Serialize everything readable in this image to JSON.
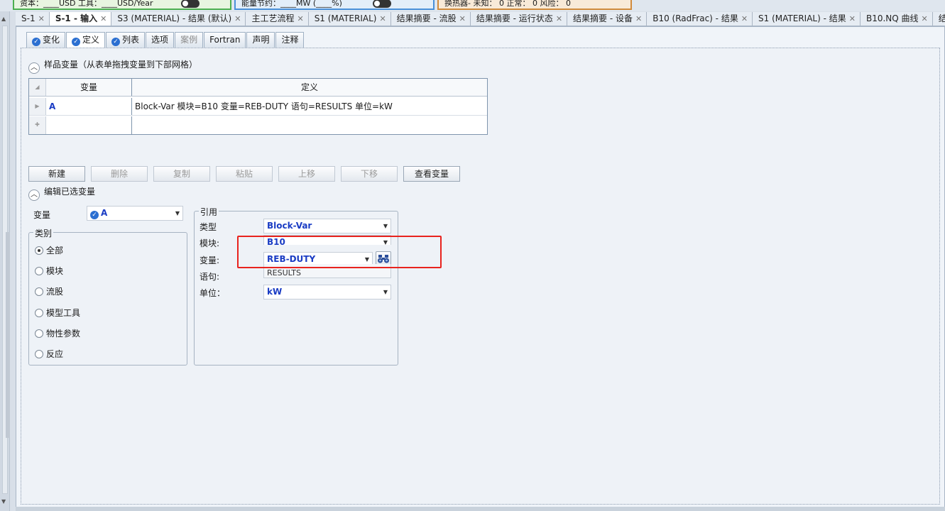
{
  "topstrip": {
    "cost": "资本：____USD  工具：____USD/Year",
    "energy": "能量节约：____MW    (____%)",
    "hx": "换热器-  未知：  0   正常：  0   风险：  0"
  },
  "doc_tabs": [
    {
      "label": "S-1",
      "active": false
    },
    {
      "label": "S-1 - 输入",
      "active": true
    },
    {
      "label": "S3 (MATERIAL) - 结果 (默认)",
      "active": false
    },
    {
      "label": "主工艺流程",
      "active": false
    },
    {
      "label": "S1 (MATERIAL)",
      "active": false
    },
    {
      "label": "结果摘要 - 流股",
      "active": false
    },
    {
      "label": "结果摘要 - 运行状态",
      "active": false
    },
    {
      "label": "结果摘要 - 设备",
      "active": false
    },
    {
      "label": "B10 (RadFrac) - 结果",
      "active": false
    },
    {
      "label": "S1 (MATERIAL) - 结果",
      "active": false
    },
    {
      "label": "B10.NQ 曲线",
      "active": false
    },
    {
      "label": "结果摘要",
      "active": false
    }
  ],
  "sub_tabs": [
    {
      "label": "变化",
      "check": true,
      "active": false,
      "disabled": false
    },
    {
      "label": "定义",
      "check": true,
      "active": true,
      "disabled": false
    },
    {
      "label": "列表",
      "check": true,
      "active": false,
      "disabled": false
    },
    {
      "label": "选项",
      "check": false,
      "active": false,
      "disabled": false
    },
    {
      "label": "案例",
      "check": false,
      "active": false,
      "disabled": true
    },
    {
      "label": "Fortran",
      "check": false,
      "active": false,
      "disabled": false
    },
    {
      "label": "声明",
      "check": false,
      "active": false,
      "disabled": false
    },
    {
      "label": "注释",
      "check": false,
      "active": false,
      "disabled": false
    }
  ],
  "sample_section": {
    "title": "样品变量（从表单拖拽变量到下部网格）",
    "grid": {
      "headers": [
        "变量",
        "定义"
      ],
      "rows": [
        {
          "variable": "A",
          "definition": "Block-Var 模块=B10 变量=REB-DUTY 语句=RESULTS 单位=kW"
        }
      ]
    }
  },
  "buttons": {
    "new": "新建",
    "delete": "删除",
    "copy": "复制",
    "paste": "粘贴",
    "up": "上移",
    "down": "下移",
    "view": "查看变量"
  },
  "edit_section": {
    "title": "编辑已选变量",
    "variable_label": "变量",
    "variable_value": "A",
    "category": {
      "title": "类别",
      "options": [
        "全部",
        "模块",
        "流股",
        "模型工具",
        "物性参数",
        "反应"
      ],
      "selected": "全部"
    },
    "reference": {
      "title": "引用",
      "type_label": "类型",
      "type_value": "Block-Var",
      "block_label": "模块:",
      "block_value": "B10",
      "var_label": "变量:",
      "var_value": "REB-DUTY",
      "sentence_label": "语句:",
      "sentence_value": "RESULTS",
      "units_label": "单位：",
      "units_value": "kW"
    }
  },
  "colors": {
    "accent": "#1a3cc4",
    "highlight": "#e8231e",
    "check": "#2b6fd1"
  }
}
